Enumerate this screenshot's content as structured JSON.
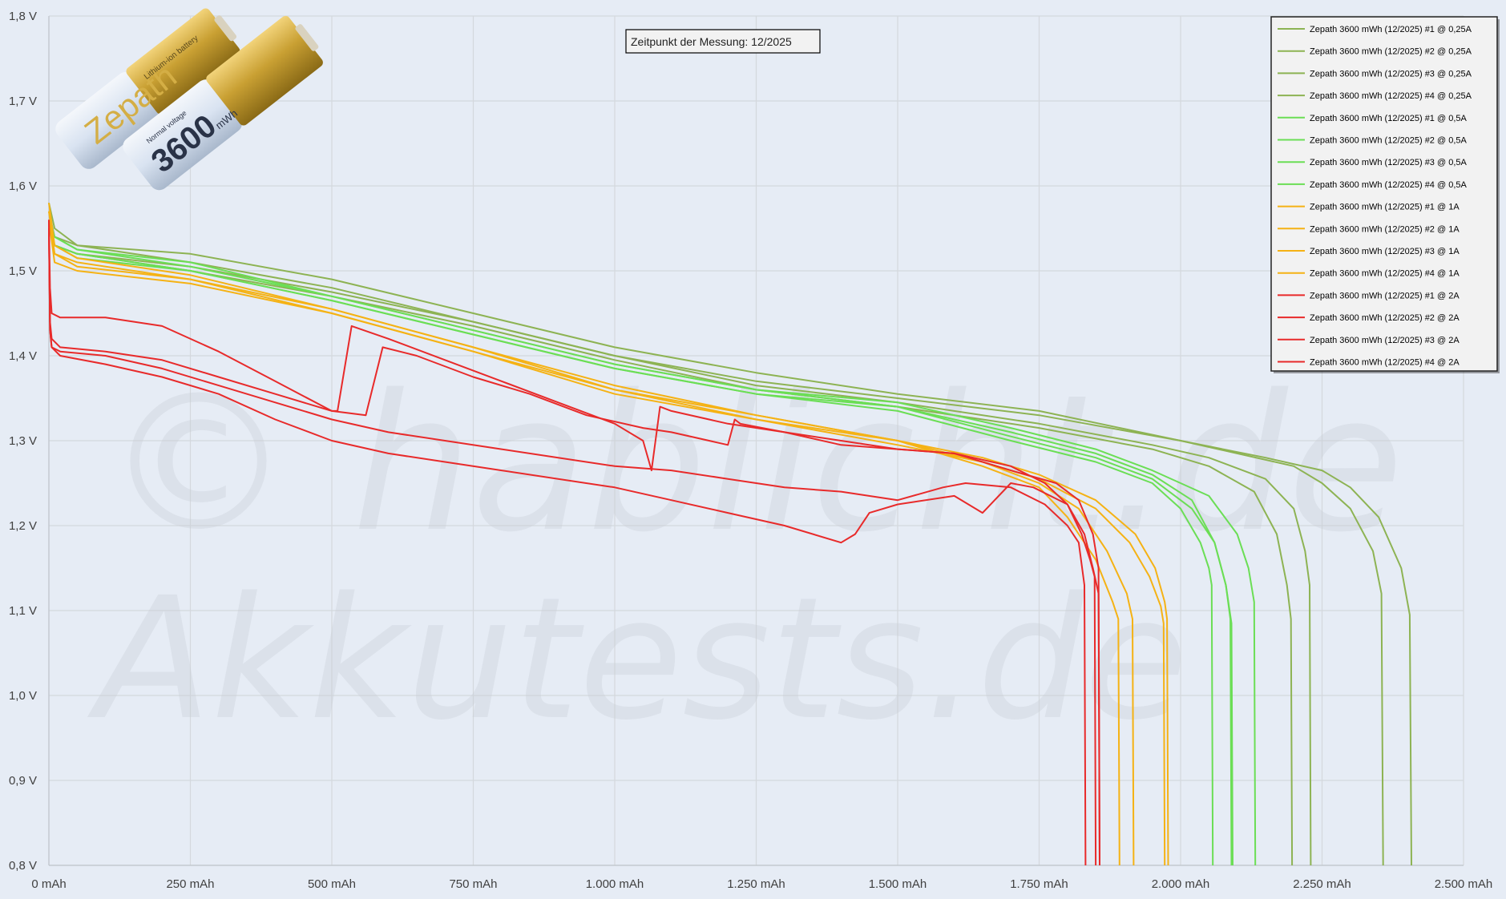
{
  "chart_data": {
    "type": "line",
    "annotation": "Zeitpunkt der Messung: 12/2025",
    "watermark_lines": [
      "© hablicht.de",
      "Akkutests.de"
    ],
    "product_image": {
      "brand": "Zepath",
      "capacity": "3600",
      "unit": "mWh",
      "small_text": [
        "Lithium-ion battery",
        "Normal voltage"
      ]
    },
    "grid": true,
    "legend_position": "top-right",
    "x_axis": {
      "lim": [
        0,
        2500
      ],
      "ticks": [
        0,
        250,
        500,
        750,
        1000,
        1250,
        1500,
        1750,
        2000,
        2250,
        2500
      ],
      "tick_labels": [
        "0 mAh",
        "250 mAh",
        "500 mAh",
        "750 mAh",
        "1.000 mAh",
        "1.250 mAh",
        "1.500 mAh",
        "1.750 mAh",
        "2.000 mAh",
        "2.250 mAh",
        "2.500 mAh"
      ]
    },
    "y_axis": {
      "lim": [
        0.8,
        1.8
      ],
      "ticks": [
        0.8,
        0.9,
        1.0,
        1.1,
        1.2,
        1.3,
        1.4,
        1.5,
        1.6,
        1.7,
        1.8
      ],
      "tick_labels": [
        "0,8 V",
        "0,9 V",
        "1,0 V",
        "1,1 V",
        "1,2 V",
        "1,3 V",
        "1,4 V",
        "1,5 V",
        "1,6 V",
        "1,7 V",
        "1,8 V"
      ]
    },
    "series": [
      {
        "name": "Zepath 3600 mWh (12/2025) #1 @ 0,25A",
        "color": "#8db353",
        "x": [
          0,
          10,
          50,
          250,
          500,
          750,
          1000,
          1250,
          1500,
          1750,
          2000,
          2100,
          2200,
          2250,
          2300,
          2340,
          2355,
          2358
        ],
        "y": [
          1.58,
          1.55,
          1.53,
          1.51,
          1.48,
          1.44,
          1.4,
          1.37,
          1.35,
          1.33,
          1.3,
          1.285,
          1.27,
          1.25,
          1.22,
          1.17,
          1.12,
          0.8
        ]
      },
      {
        "name": "Zepath 3600 mWh (12/2025) #2 @ 0,25A",
        "color": "#8db353",
        "x": [
          0,
          10,
          50,
          250,
          500,
          750,
          1000,
          1250,
          1500,
          1750,
          2000,
          2150,
          2250,
          2300,
          2350,
          2390,
          2405,
          2408
        ],
        "y": [
          1.57,
          1.54,
          1.53,
          1.52,
          1.49,
          1.45,
          1.41,
          1.38,
          1.355,
          1.335,
          1.3,
          1.28,
          1.265,
          1.245,
          1.21,
          1.15,
          1.095,
          0.8
        ]
      },
      {
        "name": "Zepath 3600 mWh (12/2025) #3 @ 0,25A",
        "color": "#8db353",
        "x": [
          0,
          10,
          50,
          250,
          500,
          750,
          1000,
          1250,
          1500,
          1750,
          1950,
          2050,
          2150,
          2200,
          2220,
          2228,
          2230
        ],
        "y": [
          1.56,
          1.53,
          1.52,
          1.505,
          1.475,
          1.44,
          1.4,
          1.365,
          1.345,
          1.32,
          1.295,
          1.28,
          1.255,
          1.22,
          1.17,
          1.13,
          0.8
        ]
      },
      {
        "name": "Zepath 3600 mWh (12/2025) #4 @ 0,25A",
        "color": "#8db353",
        "x": [
          0,
          10,
          50,
          250,
          500,
          750,
          1000,
          1250,
          1500,
          1750,
          1950,
          2050,
          2130,
          2170,
          2188,
          2195,
          2197
        ],
        "y": [
          1.56,
          1.53,
          1.52,
          1.5,
          1.47,
          1.435,
          1.395,
          1.36,
          1.34,
          1.315,
          1.29,
          1.27,
          1.24,
          1.19,
          1.13,
          1.09,
          0.8
        ]
      },
      {
        "name": "Zepath 3600 mWh (12/2025) #1 @ 0,5A",
        "color": "#6bde55",
        "x": [
          0,
          10,
          50,
          250,
          500,
          750,
          1000,
          1250,
          1500,
          1700,
          1850,
          1950,
          2020,
          2060,
          2080,
          2090,
          2092
        ],
        "y": [
          1.56,
          1.54,
          1.525,
          1.505,
          1.47,
          1.43,
          1.39,
          1.36,
          1.34,
          1.31,
          1.285,
          1.26,
          1.23,
          1.18,
          1.13,
          1.085,
          0.8
        ]
      },
      {
        "name": "Zepath 3600 mWh (12/2025) #2 @ 0,5A",
        "color": "#6bde55",
        "x": [
          0,
          10,
          50,
          250,
          500,
          750,
          1000,
          1250,
          1500,
          1700,
          1850,
          1950,
          2050,
          2100,
          2120,
          2130,
          2132
        ],
        "y": [
          1.56,
          1.54,
          1.525,
          1.51,
          1.47,
          1.43,
          1.39,
          1.36,
          1.345,
          1.315,
          1.29,
          1.265,
          1.235,
          1.19,
          1.15,
          1.11,
          0.8
        ]
      },
      {
        "name": "Zepath 3600 mWh (12/2025) #3 @ 0,5A",
        "color": "#6bde55",
        "x": [
          0,
          10,
          50,
          250,
          500,
          750,
          1000,
          1250,
          1500,
          1700,
          1850,
          1950,
          2000,
          2035,
          2050,
          2055,
          2057
        ],
        "y": [
          1.55,
          1.53,
          1.52,
          1.5,
          1.465,
          1.425,
          1.385,
          1.355,
          1.335,
          1.3,
          1.275,
          1.25,
          1.22,
          1.18,
          1.15,
          1.13,
          0.8
        ]
      },
      {
        "name": "Zepath 3600 mWh (12/2025) #4 @ 0,5A",
        "color": "#6bde55",
        "x": [
          0,
          10,
          50,
          250,
          500,
          750,
          1000,
          1250,
          1500,
          1700,
          1850,
          1950,
          2020,
          2060,
          2080,
          2088,
          2090
        ],
        "y": [
          1.55,
          1.53,
          1.515,
          1.5,
          1.465,
          1.425,
          1.385,
          1.355,
          1.34,
          1.305,
          1.28,
          1.255,
          1.22,
          1.18,
          1.13,
          1.09,
          0.8
        ]
      },
      {
        "name": "Zepath 3600 mWh (12/2025) #1 @ 1A",
        "color": "#f5b214",
        "x": [
          0,
          10,
          50,
          250,
          500,
          750,
          1000,
          1250,
          1500,
          1650,
          1750,
          1850,
          1920,
          1955,
          1972,
          1976,
          1978
        ],
        "y": [
          1.58,
          1.53,
          1.515,
          1.495,
          1.455,
          1.41,
          1.365,
          1.33,
          1.3,
          1.28,
          1.26,
          1.23,
          1.19,
          1.15,
          1.11,
          1.09,
          0.8
        ]
      },
      {
        "name": "Zepath 3600 mWh (12/2025) #2 @ 1A",
        "color": "#f5b214",
        "x": [
          0,
          10,
          50,
          250,
          500,
          750,
          1000,
          1250,
          1500,
          1650,
          1750,
          1850,
          1910,
          1945,
          1965,
          1970,
          1972
        ],
        "y": [
          1.57,
          1.52,
          1.51,
          1.49,
          1.45,
          1.405,
          1.36,
          1.325,
          1.295,
          1.275,
          1.255,
          1.22,
          1.18,
          1.14,
          1.105,
          1.085,
          0.8
        ]
      },
      {
        "name": "Zepath 3600 mWh (12/2025) #3 @ 1A",
        "color": "#f5b214",
        "x": [
          0,
          10,
          50,
          250,
          500,
          750,
          1000,
          1250,
          1500,
          1650,
          1750,
          1820,
          1870,
          1905,
          1915,
          1917
        ],
        "y": [
          1.56,
          1.52,
          1.505,
          1.49,
          1.455,
          1.41,
          1.36,
          1.33,
          1.3,
          1.275,
          1.25,
          1.22,
          1.17,
          1.12,
          1.09,
          0.8
        ]
      },
      {
        "name": "Zepath 3600 mWh (12/2025) #4 @ 1A",
        "color": "#f5b214",
        "x": [
          0,
          10,
          50,
          250,
          500,
          750,
          1000,
          1250,
          1500,
          1650,
          1750,
          1800,
          1850,
          1880,
          1890,
          1892
        ],
        "y": [
          1.56,
          1.51,
          1.5,
          1.485,
          1.45,
          1.405,
          1.355,
          1.325,
          1.3,
          1.27,
          1.245,
          1.21,
          1.16,
          1.11,
          1.09,
          0.8
        ]
      },
      {
        "name": "Zepath 3600 mWh (12/2025) #1 @ 2A",
        "color": "#e82a2a",
        "x": [
          0,
          2,
          5,
          20,
          100,
          200,
          300,
          400,
          500,
          510,
          535,
          600,
          700,
          800,
          900,
          1000,
          1050,
          1065,
          1080,
          1100,
          1200,
          1300,
          1400,
          1500,
          1600,
          1700,
          1780,
          1820,
          1845,
          1855,
          1857
        ],
        "y": [
          1.56,
          1.48,
          1.45,
          1.445,
          1.445,
          1.435,
          1.405,
          1.37,
          1.335,
          1.335,
          1.435,
          1.42,
          1.395,
          1.37,
          1.345,
          1.32,
          1.3,
          1.265,
          1.34,
          1.335,
          1.32,
          1.31,
          1.3,
          1.29,
          1.285,
          1.265,
          1.25,
          1.23,
          1.19,
          1.15,
          0.8
        ]
      },
      {
        "name": "Zepath 3600 mWh (12/2025) #2 @ 2A",
        "color": "#e82a2a",
        "x": [
          0,
          2,
          5,
          20,
          100,
          200,
          300,
          400,
          500,
          560,
          590,
          650,
          750,
          850,
          950,
          1050,
          1100,
          1200,
          1212,
          1222,
          1300,
          1400,
          1500,
          1600,
          1700,
          1760,
          1800,
          1825,
          1840,
          1848,
          1850
        ],
        "y": [
          1.55,
          1.44,
          1.42,
          1.41,
          1.405,
          1.395,
          1.375,
          1.355,
          1.335,
          1.33,
          1.41,
          1.4,
          1.375,
          1.355,
          1.33,
          1.315,
          1.31,
          1.295,
          1.325,
          1.32,
          1.31,
          1.295,
          1.29,
          1.285,
          1.27,
          1.25,
          1.225,
          1.19,
          1.16,
          1.14,
          0.8
        ]
      },
      {
        "name": "Zepath 3600 mWh (12/2025) #3 @ 2A",
        "color": "#e82a2a",
        "x": [
          0,
          2,
          5,
          20,
          100,
          200,
          300,
          400,
          500,
          600,
          700,
          800,
          900,
          1000,
          1100,
          1200,
          1300,
          1400,
          1425,
          1450,
          1500,
          1600,
          1650,
          1700,
          1740,
          1800,
          1830,
          1845,
          1855,
          1857
        ],
        "y": [
          1.55,
          1.43,
          1.41,
          1.4,
          1.39,
          1.375,
          1.355,
          1.325,
          1.3,
          1.285,
          1.275,
          1.265,
          1.255,
          1.245,
          1.23,
          1.215,
          1.2,
          1.18,
          1.19,
          1.215,
          1.225,
          1.235,
          1.215,
          1.25,
          1.245,
          1.225,
          1.19,
          1.15,
          1.12,
          0.8
        ]
      },
      {
        "name": "Zepath 3600 mWh (12/2025) #4 @ 2A",
        "color": "#e82a2a",
        "x": [
          0,
          2,
          5,
          20,
          100,
          200,
          300,
          400,
          500,
          600,
          700,
          800,
          900,
          1000,
          1100,
          1200,
          1300,
          1400,
          1500,
          1580,
          1620,
          1700,
          1760,
          1800,
          1820,
          1830,
          1832
        ],
        "y": [
          1.56,
          1.43,
          1.41,
          1.405,
          1.4,
          1.385,
          1.365,
          1.345,
          1.325,
          1.31,
          1.3,
          1.29,
          1.28,
          1.27,
          1.265,
          1.255,
          1.245,
          1.24,
          1.23,
          1.245,
          1.25,
          1.245,
          1.225,
          1.2,
          1.18,
          1.13,
          0.8
        ]
      }
    ]
  }
}
